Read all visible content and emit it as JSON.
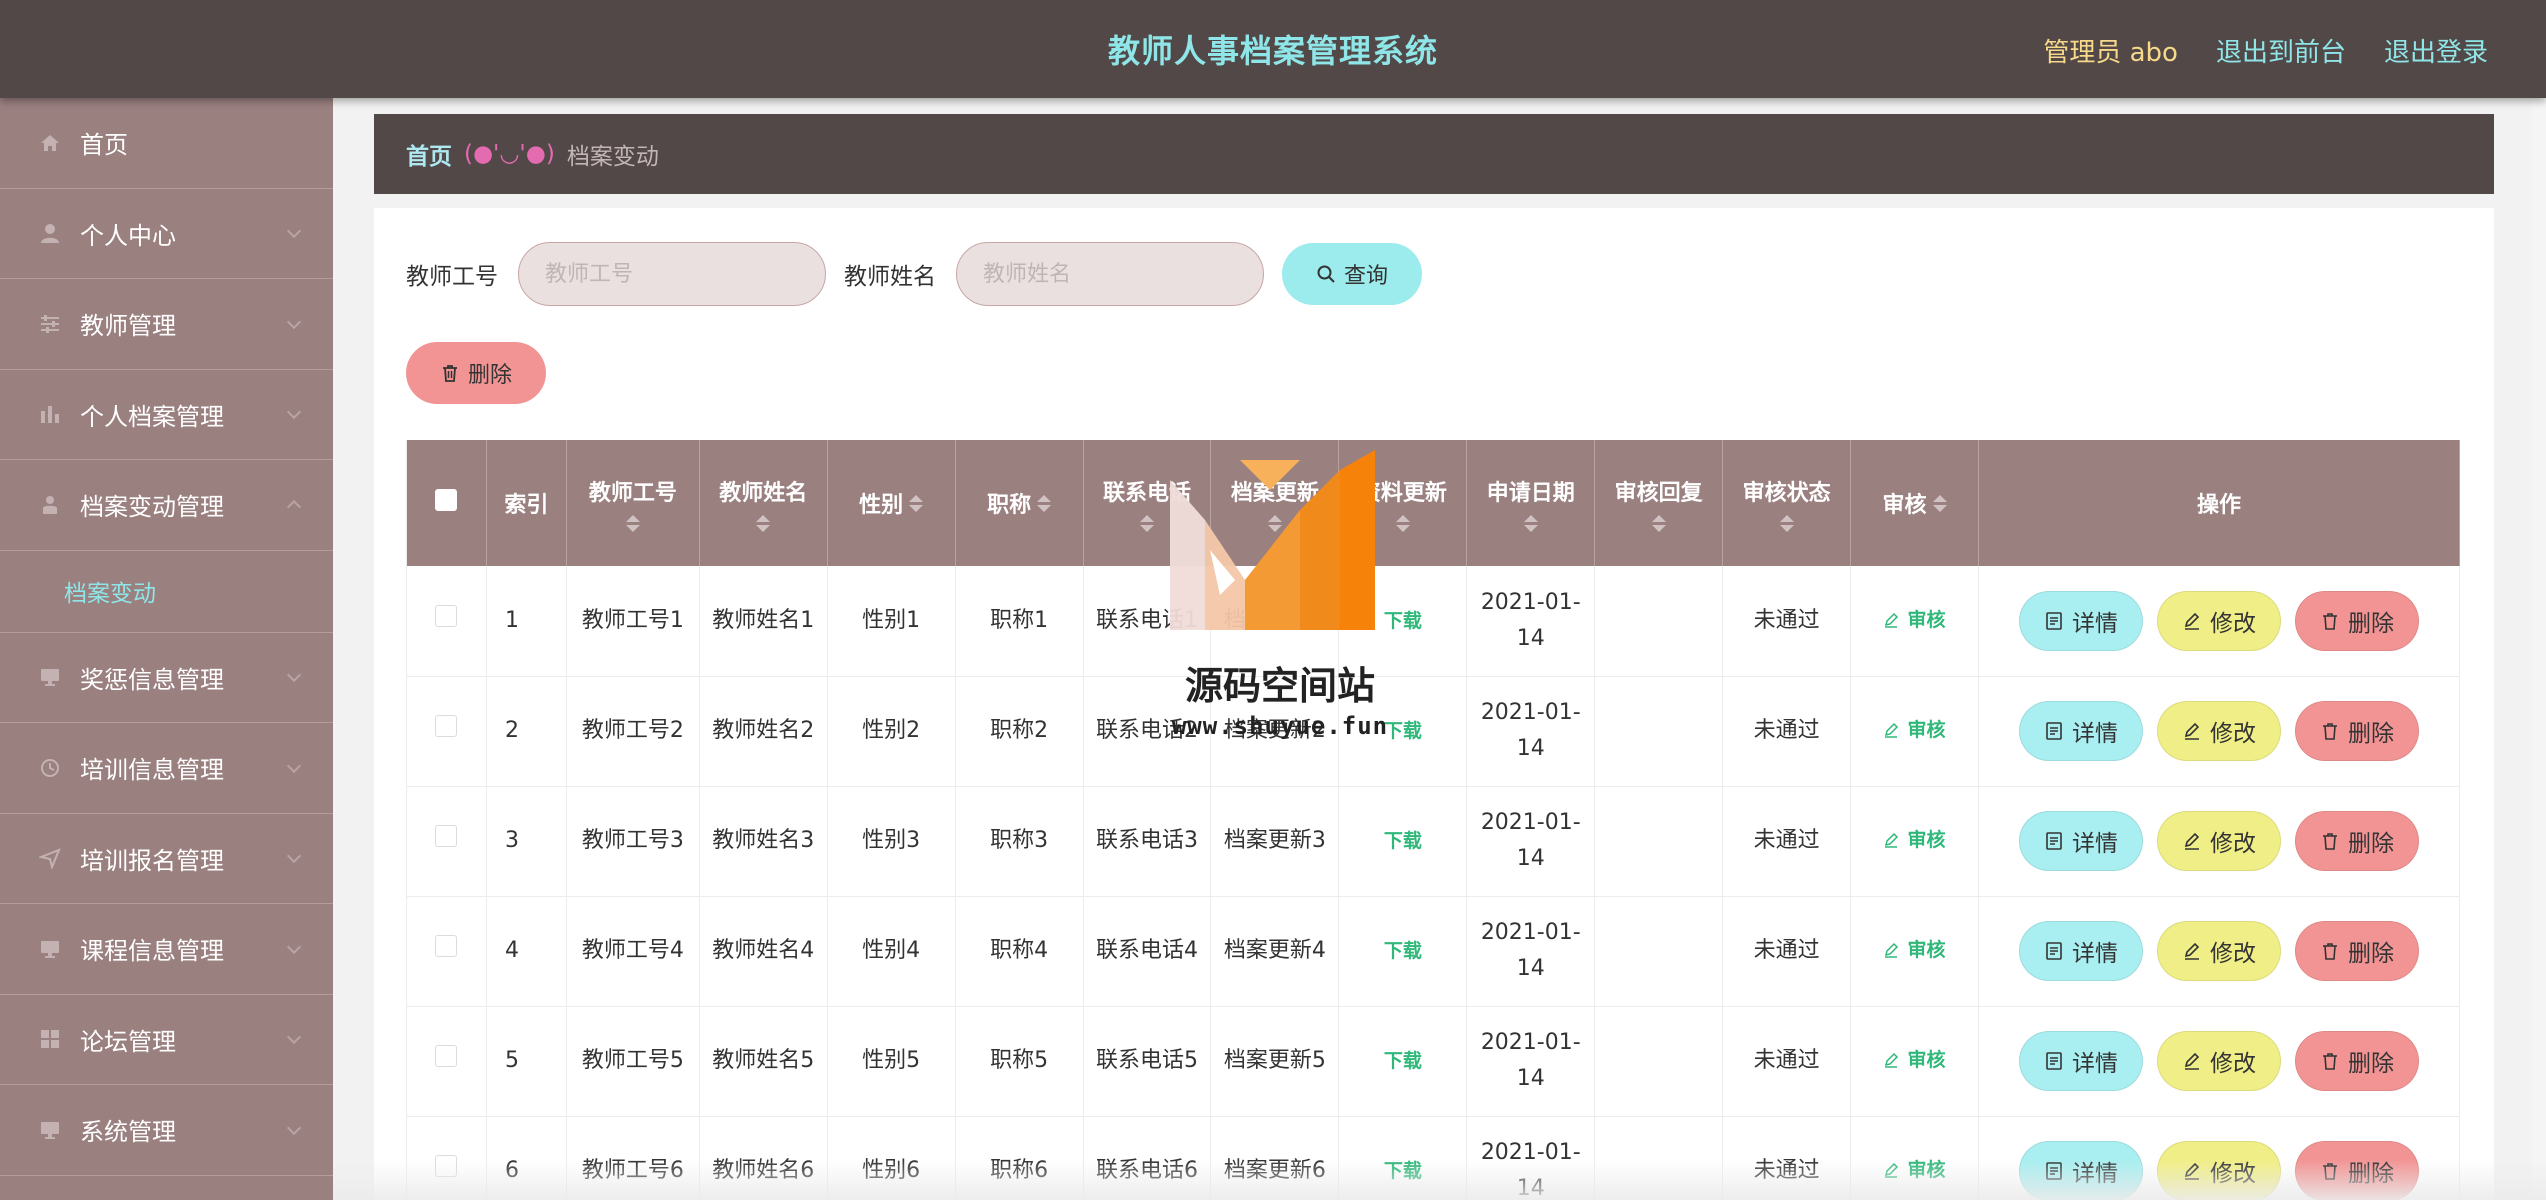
{
  "header": {
    "title": "教师人事档案管理系统",
    "admin_label": "管理员 abo",
    "to_front": "退出到前台",
    "logout": "退出登录"
  },
  "sidebar": {
    "items": [
      {
        "label": "首页",
        "icon": "home-icon"
      },
      {
        "label": "个人中心",
        "icon": "user-icon"
      },
      {
        "label": "教师管理",
        "icon": "sliders-icon"
      },
      {
        "label": "个人档案管理",
        "icon": "chart-icon"
      },
      {
        "label": "档案变动管理",
        "icon": "person-icon"
      },
      {
        "label": "奖惩信息管理",
        "icon": "monitor-icon"
      },
      {
        "label": "培训信息管理",
        "icon": "clock-icon"
      },
      {
        "label": "培训报名管理",
        "icon": "send-icon"
      },
      {
        "label": "课程信息管理",
        "icon": "monitor-icon"
      },
      {
        "label": "论坛管理",
        "icon": "grid-icon"
      },
      {
        "label": "系统管理",
        "icon": "monitor-icon"
      }
    ],
    "sub_item": "档案变动"
  },
  "breadcrumb": {
    "home": "首页",
    "sep": "(●'◡'●)",
    "current": "档案变动"
  },
  "search": {
    "label1": "教师工号",
    "placeholder1": "教师工号",
    "label2": "教师姓名",
    "placeholder2": "教师姓名",
    "query_btn": "查询"
  },
  "delete_btn": "删除",
  "table": {
    "headers": [
      "索引",
      "教师工号",
      "教师姓名",
      "性别",
      "职称",
      "联系电话",
      "档案更新",
      "资料更新",
      "申请日期",
      "审核回复",
      "审核状态",
      "审核",
      "操作"
    ],
    "rows": [
      {
        "idx": "1",
        "no": "教师工号1",
        "name": "教师姓名1",
        "sex": "性别1",
        "title": "职称1",
        "phone": "联系电话1",
        "update": "档案更新1",
        "file": "下载",
        "date": "2021-01-14",
        "reply": "",
        "status": "未通过",
        "audit": "审核"
      },
      {
        "idx": "2",
        "no": "教师工号2",
        "name": "教师姓名2",
        "sex": "性别2",
        "title": "职称2",
        "phone": "联系电话2",
        "update": "档案更新2",
        "file": "下载",
        "date": "2021-01-14",
        "reply": "",
        "status": "未通过",
        "audit": "审核"
      },
      {
        "idx": "3",
        "no": "教师工号3",
        "name": "教师姓名3",
        "sex": "性别3",
        "title": "职称3",
        "phone": "联系电话3",
        "update": "档案更新3",
        "file": "下载",
        "date": "2021-01-14",
        "reply": "",
        "status": "未通过",
        "audit": "审核"
      },
      {
        "idx": "4",
        "no": "教师工号4",
        "name": "教师姓名4",
        "sex": "性别4",
        "title": "职称4",
        "phone": "联系电话4",
        "update": "档案更新4",
        "file": "下载",
        "date": "2021-01-14",
        "reply": "",
        "status": "未通过",
        "audit": "审核"
      },
      {
        "idx": "5",
        "no": "教师工号5",
        "name": "教师姓名5",
        "sex": "性别5",
        "title": "职称5",
        "phone": "联系电话5",
        "update": "档案更新5",
        "file": "下载",
        "date": "2021-01-14",
        "reply": "",
        "status": "未通过",
        "audit": "审核"
      },
      {
        "idx": "6",
        "no": "教师工号6",
        "name": "教师姓名6",
        "sex": "性别6",
        "title": "职称6",
        "phone": "联系电话6",
        "update": "档案更新6",
        "file": "下载",
        "date": "2021-01-14",
        "reply": "",
        "status": "未通过",
        "audit": "审核"
      }
    ],
    "ops": {
      "detail": "详情",
      "edit": "修改",
      "del": "删除"
    }
  },
  "watermark": {
    "text": "源码空间站",
    "url": "www.shuyue.fun"
  }
}
